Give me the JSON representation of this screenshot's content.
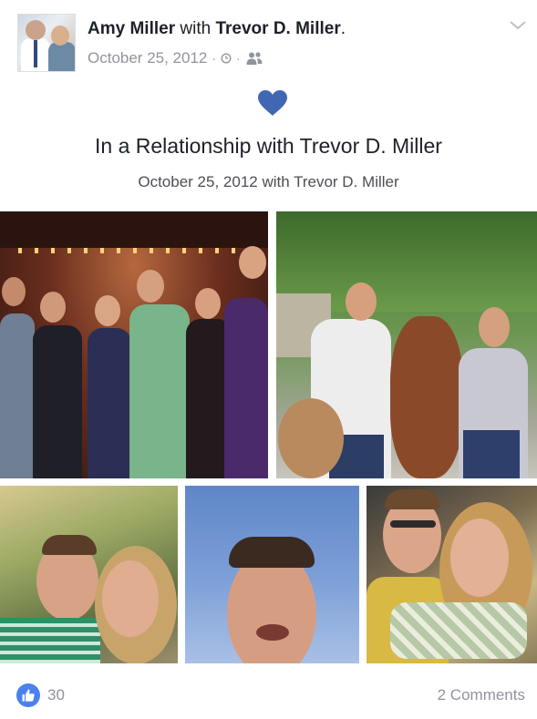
{
  "post": {
    "author": "Amy Miller",
    "with_word": "with",
    "tagged": "Trevor D. Miller",
    "period": ".",
    "date": "October 25, 2012",
    "separator": "·"
  },
  "life_event": {
    "title": "In a Relationship with Trevor D. Miller",
    "subtitle": "October 25, 2012 with Trevor D. Miller"
  },
  "footer": {
    "like_count": "30",
    "comments": "2 Comments"
  },
  "colors": {
    "accent": "#4267b2",
    "like_blue": "#4c80ed",
    "meta_gray": "#90949c"
  },
  "icons": {
    "chevron": "chevron-down-icon",
    "clock": "clock-icon",
    "friends": "friends-icon",
    "heart": "heart-icon",
    "like": "thumbs-up-icon"
  }
}
